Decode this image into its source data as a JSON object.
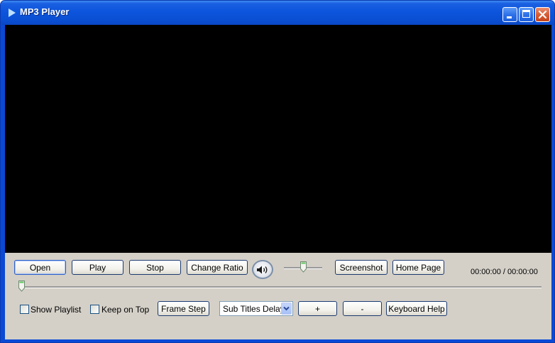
{
  "window": {
    "title": "MP3 Player"
  },
  "controls": {
    "open_label": "Open",
    "play_label": "Play",
    "stop_label": "Stop",
    "change_ratio_label": "Change Ratio",
    "screenshot_label": "Screenshot",
    "home_page_label": "Home Page",
    "time_display": "00:00:00 / 00:00:00",
    "show_playlist_label": "Show Playlist",
    "show_playlist_checked": false,
    "keep_on_top_label": "Keep on Top",
    "keep_on_top_checked": false,
    "frame_step_label": "Frame Step",
    "subtitles_select_value": "Sub Titles Delay",
    "plus_label": "+",
    "minus_label": "-",
    "keyboard_help_label": "Keyboard Help",
    "volume_level": 0.5,
    "seek_position": 0
  },
  "icons": {
    "title_icon": "play-arrow-icon",
    "sound_icon": "speaker-icon"
  },
  "colors": {
    "titlebar": "#0a4fd3",
    "video_background": "#000000",
    "panel_background": "#d4d0c8"
  }
}
